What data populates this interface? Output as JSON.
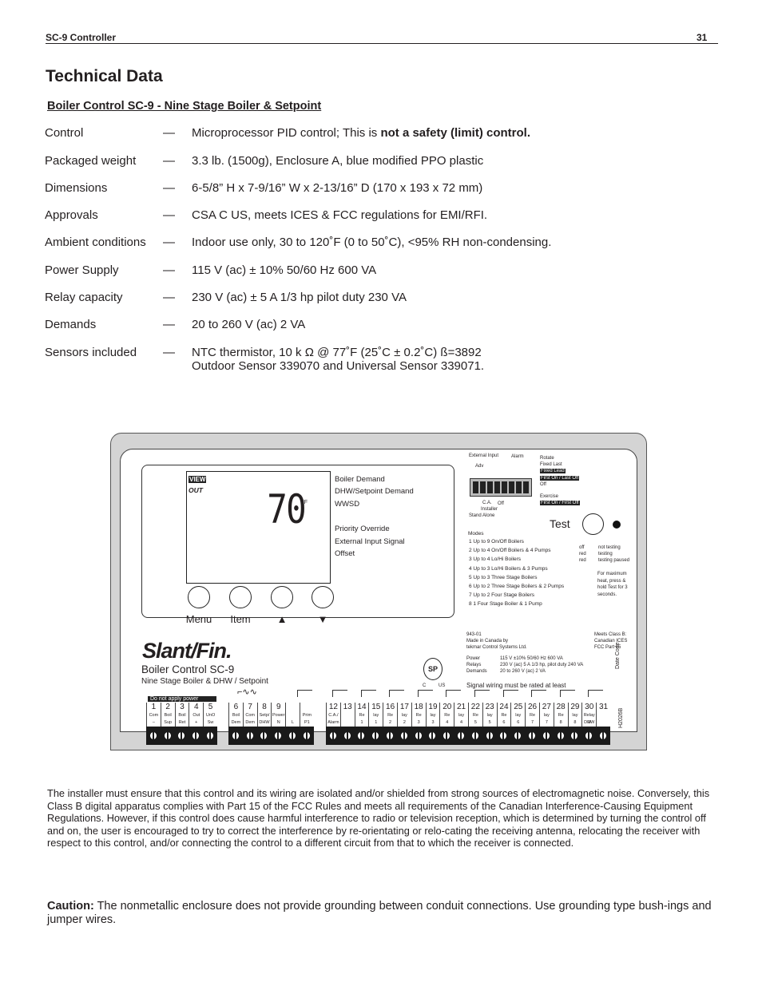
{
  "header": {
    "left": "SC-9 Controller",
    "page_number": "31"
  },
  "title": "Technical Data",
  "subtitle": "Boiler Control SC-9 - Nine Stage Boiler & Setpoint",
  "specs": [
    {
      "key": "Control",
      "value": "Microprocessor PID control; This is ",
      "value_bold": "not a safety (limit) control."
    },
    {
      "key": "Packaged weight",
      "value": "3.3 lb. (1500g), Enclosure A, blue modified PPO plastic"
    },
    {
      "key": "Dimensions",
      "value": "6-5/8” H x 7-9/16” W x 2-13/16” D (170 x 193 x 72 mm)"
    },
    {
      "key": "Approvals",
      "value": "CSA C US, meets ICES & FCC regulations for EMI/RFI."
    },
    {
      "key": "Ambient conditions",
      "value": "Indoor use only, 30 to 120˚F (0 to 50˚C), <95% RH non-condensing."
    },
    {
      "key": "Power Supply",
      "value": "115 V (ac) ± 10% 50/60 Hz 600 VA"
    },
    {
      "key": "Relay capacity",
      "value": "230 V (ac) ± 5 A 1/3 hp pilot duty 230 VA"
    },
    {
      "key": "Demands",
      "value": "20 to 260 V (ac) 2 VA"
    },
    {
      "key": "Sensors included",
      "value": "NTC thermistor, 10 k Ω @ 77˚F (25˚C ± 0.2˚C) ß=3892",
      "value2": "Outdoor Sensor 339070 and Universal Sensor 339071."
    }
  ],
  "dash": "—",
  "device": {
    "lcd": {
      "view": "VIEW",
      "out": "OUT",
      "temp": "70",
      "unit": "°F"
    },
    "indicators": [
      "Boiler Demand",
      "DHW/Setpoint Demand",
      "WWSD",
      "Priority Override",
      "External Input Signal",
      "Offset"
    ],
    "buttons": [
      "Menu",
      "Item",
      "▲",
      "▼"
    ],
    "dip_labels": {
      "external_input": "External Input",
      "alarm": "Alarm",
      "adv": "Adv",
      "rotate": "Rotate",
      "fixed_last": "Fixed Last",
      "fixed_lead": "Fixed Lead",
      "first_on_last_off": "First On / Last Off",
      "off": "Off",
      "exercise": "Exercise",
      "first_on_first_off": "First On / First Off",
      "ca": "C.A.",
      "off2": "Off",
      "installer": "Installer",
      "stand_alone": "Stand Alone"
    },
    "test": "Test",
    "modes_title": "Modes",
    "modes": [
      "1  Up to 9 On/Off Boilers",
      "2  Up to 4 On/Off Boilers & 4 Pumps",
      "3  Up to 4 Lo/Hi Boilers",
      "4  Up to 3 Lo/Hi Boilers & 3 Pumps",
      "5  Up to 3 Three Stage Boilers",
      "6  Up to 2 Three Stage Boilers & 2 Pumps",
      "7  Up to 2 Four Stage Boilers",
      "8  1 Four Stage Boiler & 1 Pump"
    ],
    "led_states": [
      "off",
      "red",
      "red"
    ],
    "led_meaning": [
      "not testing",
      "testing",
      "testing paused"
    ],
    "test_note": [
      "For maximum",
      "heat, press &",
      "hold Test for 3",
      "seconds."
    ],
    "brand": "Slant/Fin.",
    "model": "Boiler Control SC-9",
    "model_sub": "Nine Stage Boiler & DHW / Setpoint",
    "maker": [
      "943-01",
      "Made in Canada by",
      "tekmar Control Systems Ltd."
    ],
    "class_b": [
      "Meets Class B:",
      "Canadian ICES",
      "FCC Part 15"
    ],
    "ratings": [
      [
        "Power",
        "115 V ±10% 50/60 Hz 600 VA"
      ],
      [
        "Relays",
        "230 V (ac) 5 A 1/3 hp, pilot duty 240 VA"
      ],
      [
        "Demands",
        "20 to 260 V (ac) 2 VA"
      ]
    ],
    "csa": {
      "mark": "SP",
      "c": "C",
      "us": "US"
    },
    "signal": "Signal wiring must be rated at least",
    "date_code": "Date Code",
    "h_code": "H2026B",
    "do_not_apply": "Do not apply power",
    "terminal_groups": [
      [
        {
          "n": "1",
          "a": "Com",
          "b": "–"
        },
        {
          "n": "2",
          "a": "Boil",
          "b": "Sup"
        },
        {
          "n": "3",
          "a": "Boil",
          "b": "Ret"
        },
        {
          "n": "4",
          "a": "Out",
          "b": "+"
        },
        {
          "n": "5",
          "a": "UnO",
          "b": "Sw"
        }
      ],
      [
        {
          "n": "6",
          "a": "Boil",
          "b": "Dem"
        },
        {
          "n": "7",
          "a": "Com",
          "b": "Dem"
        },
        {
          "n": "8",
          "a": "Setp/",
          "b": "DHW"
        },
        {
          "n": "9",
          "a": "Power",
          "b": "N"
        },
        {
          "n": "",
          "a": "",
          "b": "L"
        },
        {
          "n": "",
          "a": "Prim",
          "b": "P1"
        }
      ],
      [
        {
          "n": "12",
          "a": "C.A./",
          "b": "Alarm"
        },
        {
          "n": "13",
          "a": "",
          "b": ""
        },
        {
          "n": "14",
          "a": "Re",
          "b": "1"
        },
        {
          "n": "15",
          "a": "lay",
          "b": "1"
        },
        {
          "n": "16",
          "a": "Re",
          "b": "2"
        },
        {
          "n": "17",
          "a": "lay",
          "b": "2"
        },
        {
          "n": "18",
          "a": "Re",
          "b": "3"
        },
        {
          "n": "19",
          "a": "lay",
          "b": "3"
        },
        {
          "n": "20",
          "a": "Re",
          "b": "4"
        },
        {
          "n": "21",
          "a": "lay",
          "b": "4"
        },
        {
          "n": "22",
          "a": "Re",
          "b": "5"
        },
        {
          "n": "23",
          "a": "lay",
          "b": "5"
        },
        {
          "n": "24",
          "a": "Re",
          "b": "6"
        },
        {
          "n": "25",
          "a": "lay",
          "b": "6"
        },
        {
          "n": "26",
          "a": "Re",
          "b": "7"
        },
        {
          "n": "27",
          "a": "lay",
          "b": "7"
        },
        {
          "n": "28",
          "a": "Re",
          "b": "8"
        },
        {
          "n": "29",
          "a": "lay",
          "b": "8"
        },
        {
          "n": "30",
          "a": "Relay 9/",
          "b": "DHW"
        },
        {
          "n": "31",
          "a": "",
          "b": ""
        }
      ]
    ]
  },
  "fcc_paragraph": "The installer must ensure that this control and its wiring are isolated and/or shielded from strong sources of electromagnetic noise. Conversely, this Class B digital apparatus complies with Part 15 of the FCC Rules and meets all requirements of the Canadian Interference-Causing Equipment Regulations. However, if this control does cause harmful interference to radio or television reception, which is determined by turning the control off and on, the user is encouraged to try to correct the interference by re-orientating or relo-cating the receiving antenna, relocating the receiver with respect to this control, and/or connecting the control to a different circuit from that to which the receiver is connected.",
  "caution": {
    "label": "Caution:",
    "text": " The nonmetallic enclosure does not provide grounding between conduit connections. Use grounding type bush-ings and jumper wires."
  }
}
